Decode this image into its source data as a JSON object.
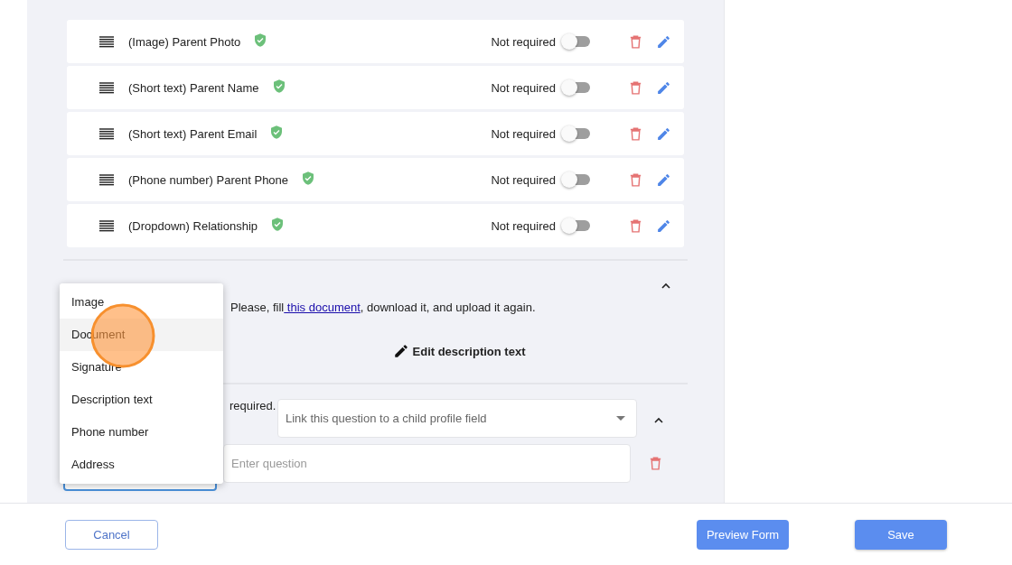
{
  "fields": [
    {
      "label": "(Image) Parent Photo",
      "verified": true,
      "required_label": "Not required",
      "required": false
    },
    {
      "label": "(Short text) Parent Name",
      "verified": true,
      "required_label": "Not required",
      "required": false
    },
    {
      "label": "(Short text) Parent Email",
      "verified": true,
      "required_label": "Not required",
      "required": false
    },
    {
      "label": "(Phone number) Parent Phone",
      "verified": true,
      "required_label": "Not required",
      "required": false
    },
    {
      "label": "(Dropdown) Relationship",
      "verified": true,
      "required_label": "Not required",
      "required": false
    }
  ],
  "document_section": {
    "expanded": true,
    "description": {
      "before": "Please, fill",
      "link": " this document",
      "after": ", download it, and upload it again."
    },
    "edit_button": "Edit description text"
  },
  "question": {
    "required_text": "required.",
    "expanded": true,
    "link_select": {
      "placeholder": "Link this question to a child profile field"
    },
    "question_input": {
      "placeholder": "Enter question"
    }
  },
  "type_menu": {
    "items": [
      {
        "label": "Image",
        "selected": false
      },
      {
        "label": "Document",
        "selected": true
      },
      {
        "label": "Signature",
        "selected": false
      },
      {
        "label": "Description text",
        "selected": false
      },
      {
        "label": "Phone number",
        "selected": false
      },
      {
        "label": "Address",
        "selected": false
      }
    ]
  },
  "footer": {
    "cancel": "Cancel",
    "preview": "Preview Form",
    "save": "Save"
  }
}
